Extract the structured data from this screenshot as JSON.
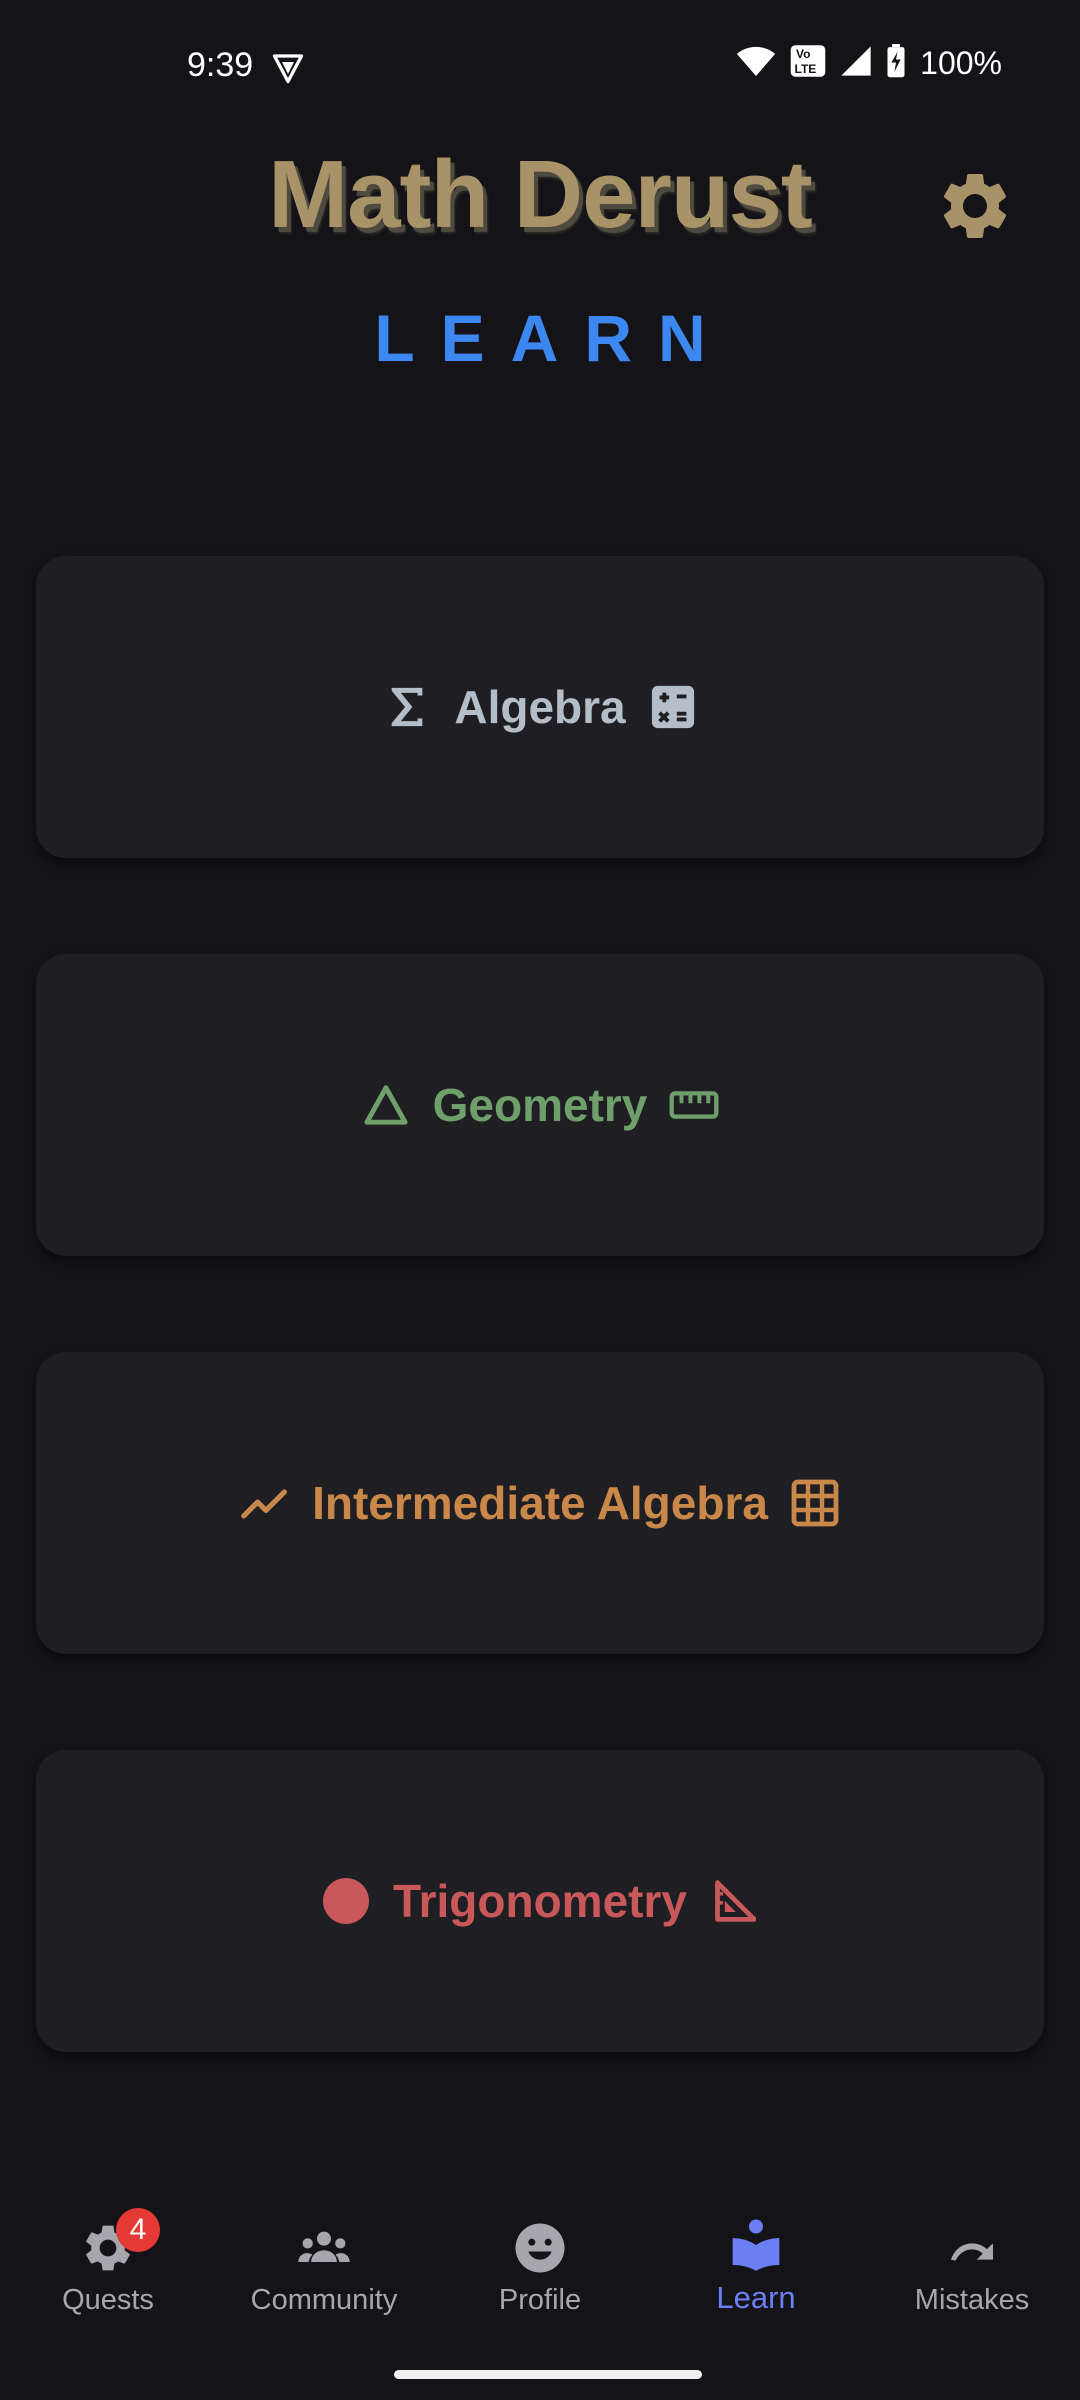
{
  "status_bar": {
    "time": "9:39",
    "battery": "100%",
    "icons": [
      "vpn-icon",
      "wifi-icon",
      "volte-icon",
      "signal-icon",
      "battery-charging-icon"
    ]
  },
  "header": {
    "app_title": "Math Derust",
    "section_title": "LEARN",
    "settings_icon": "gear-icon"
  },
  "topics": [
    {
      "label": "Algebra",
      "color": "#b4bec8",
      "left_icon": "sigma-icon",
      "right_icon": "calculator-icon"
    },
    {
      "label": "Geometry",
      "color": "#6f9f6a",
      "left_icon": "triangle-icon",
      "right_icon": "ruler-icon"
    },
    {
      "label": "Intermediate Algebra",
      "color": "#c9874a",
      "left_icon": "trending-up-icon",
      "right_icon": "grid-icon"
    },
    {
      "label": "Trigonometry",
      "color": "#c9585a",
      "left_icon": "circle-icon",
      "right_icon": "set-square-icon"
    }
  ],
  "bottom_nav": {
    "items": [
      {
        "label": "Quests",
        "icon": "quests-gear-icon",
        "badge": "4"
      },
      {
        "label": "Community",
        "icon": "people-icon"
      },
      {
        "label": "Profile",
        "icon": "smiley-face-icon"
      },
      {
        "label": "Learn",
        "icon": "book-reader-icon",
        "active": true
      },
      {
        "label": "Mistakes",
        "icon": "redo-arrow-icon"
      }
    ],
    "active_color": "#6b7ff5",
    "inactive_color": "#a8a6ad",
    "badge_color": "#e53935"
  }
}
